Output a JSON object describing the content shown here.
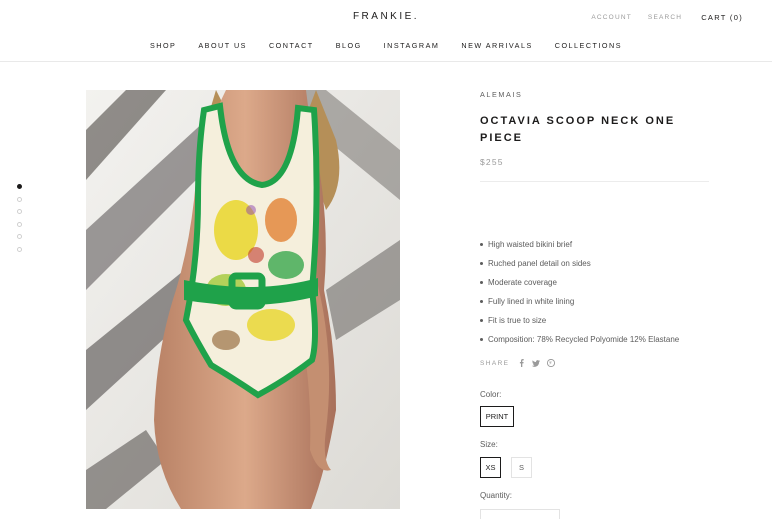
{
  "header": {
    "logo": "FRANKIE.",
    "account": "ACCOUNT",
    "search": "SEARCH",
    "cart": "CART (0)"
  },
  "nav": [
    "SHOP",
    "ABOUT US",
    "CONTACT",
    "BLOG",
    "INSTAGRAM",
    "NEW ARRIVALS",
    "COLLECTIONS"
  ],
  "gallery": {
    "image_count": 6,
    "active_index": 0
  },
  "product": {
    "brand": "ALEMAIS",
    "title": "OCTAVIA SCOOP NECK ONE PIECE",
    "price": "$255",
    "features": [
      "High waisted bikini brief",
      "Ruched panel detail on sides",
      "Moderate coverage",
      "Fully lined in white lining",
      "Fit is true to size",
      "Composition: 78% Recycled Polyomide 12% Elastane"
    ],
    "share_label": "SHARE",
    "share_icons": [
      "facebook-icon",
      "twitter-icon",
      "pinterest-icon"
    ],
    "color_label": "Color:",
    "color_options": [
      "PRINT"
    ],
    "color_selected": "PRINT",
    "size_label": "Size:",
    "size_options": [
      "XS",
      "S"
    ],
    "size_selected": "XS",
    "quantity_label": "Quantity:"
  },
  "colors": {
    "text": "#1c1b1b",
    "muted": "#9a9a9a",
    "swimsuit_green": "#1fa24a",
    "print_yellow": "#e9d62c"
  }
}
